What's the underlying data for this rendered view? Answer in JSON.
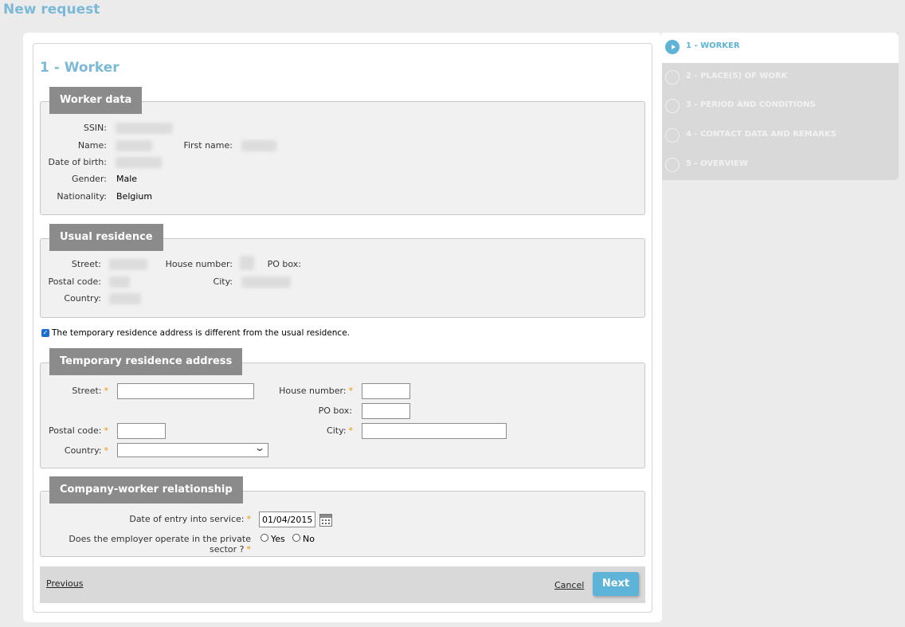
{
  "page": {
    "title": "New request"
  },
  "form": {
    "step_title": "1 - Worker",
    "worker_data": {
      "legend": "Worker data",
      "ssin_label": "SSIN:",
      "name_label": "Name:",
      "first_name_label": "First name:",
      "dob_label": "Date of birth:",
      "gender_label": "Gender:",
      "gender_value": "Male",
      "nationality_label": "Nationality:",
      "nationality_value": "Belgium"
    },
    "usual_residence": {
      "legend": "Usual residence",
      "street_label": "Street:",
      "house_number_label": "House number:",
      "po_box_label": "PO box:",
      "postal_code_label": "Postal code:",
      "city_label": "City:",
      "country_label": "Country:"
    },
    "temp_checkbox_label": "The temporary residence address is different from the usual residence.",
    "temporary_residence": {
      "legend": "Temporary residence address",
      "street_label": "Street:",
      "house_number_label": "House number:",
      "po_box_label": "PO box:",
      "postal_code_label": "Postal code:",
      "city_label": "City:",
      "country_label": "Country:",
      "required_mark": "*"
    },
    "relationship": {
      "legend": "Company-worker relationship",
      "entry_date_label": "Date of entry into service:",
      "entry_date_value": "01/04/2015",
      "private_sector_label": "Does the employer operate in the private sector ?",
      "yes_label": "Yes",
      "no_label": "No"
    },
    "buttons": {
      "previous": "Previous",
      "cancel": "Cancel",
      "next": "Next"
    }
  },
  "steps": [
    {
      "label": "1 - WORKER",
      "active": true
    },
    {
      "label": "2 - PLACE(S) OF WORK",
      "active": false
    },
    {
      "label": "3 - PERIOD AND CONDITIONS",
      "active": false
    },
    {
      "label": "4 - CONTACT DATA AND REMARKS",
      "active": false
    },
    {
      "label": "5 - OVERVIEW",
      "active": false
    }
  ],
  "colors": {
    "accent": "#5db3d8",
    "title": "#7bbad7",
    "required": "#f29400",
    "legend_bg": "#8b8b8b"
  }
}
